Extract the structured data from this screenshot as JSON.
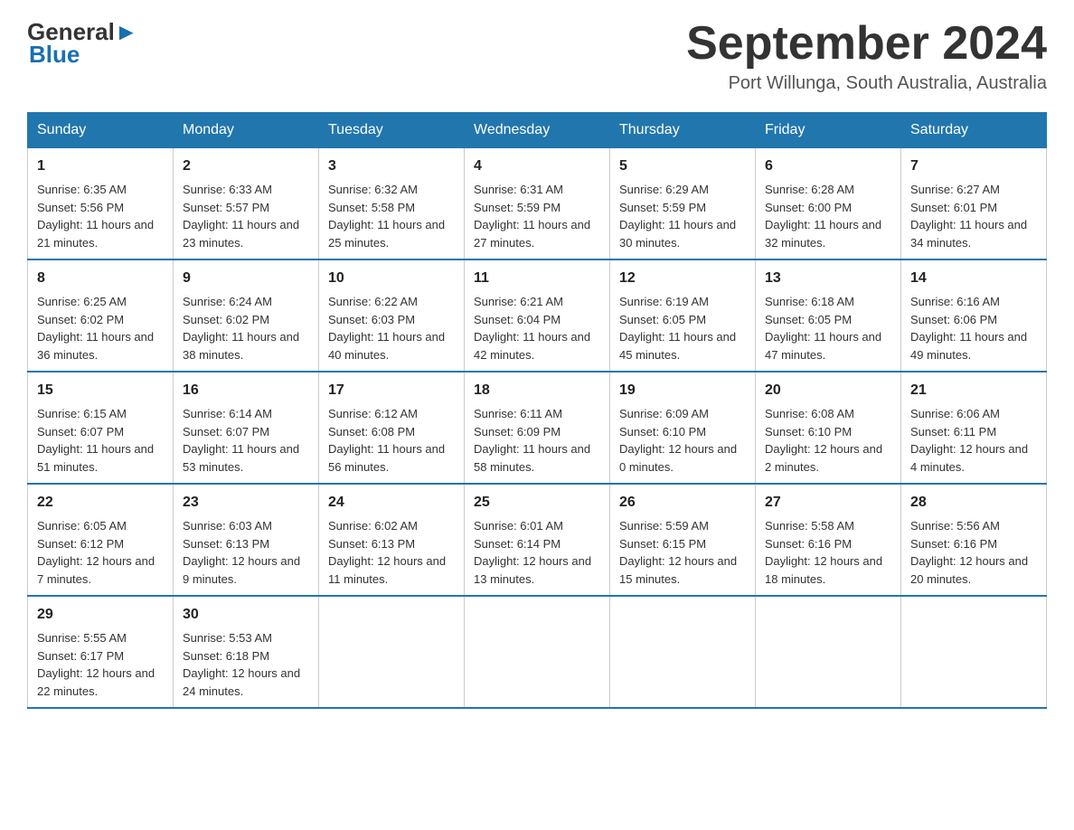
{
  "header": {
    "logo_general": "General",
    "logo_blue": "Blue",
    "month_title": "September 2024",
    "location": "Port Willunga, South Australia, Australia"
  },
  "days_of_week": [
    "Sunday",
    "Monday",
    "Tuesday",
    "Wednesday",
    "Thursday",
    "Friday",
    "Saturday"
  ],
  "weeks": [
    [
      {
        "day": "1",
        "sunrise": "6:35 AM",
        "sunset": "5:56 PM",
        "daylight": "11 hours and 21 minutes."
      },
      {
        "day": "2",
        "sunrise": "6:33 AM",
        "sunset": "5:57 PM",
        "daylight": "11 hours and 23 minutes."
      },
      {
        "day": "3",
        "sunrise": "6:32 AM",
        "sunset": "5:58 PM",
        "daylight": "11 hours and 25 minutes."
      },
      {
        "day": "4",
        "sunrise": "6:31 AM",
        "sunset": "5:59 PM",
        "daylight": "11 hours and 27 minutes."
      },
      {
        "day": "5",
        "sunrise": "6:29 AM",
        "sunset": "5:59 PM",
        "daylight": "11 hours and 30 minutes."
      },
      {
        "day": "6",
        "sunrise": "6:28 AM",
        "sunset": "6:00 PM",
        "daylight": "11 hours and 32 minutes."
      },
      {
        "day": "7",
        "sunrise": "6:27 AM",
        "sunset": "6:01 PM",
        "daylight": "11 hours and 34 minutes."
      }
    ],
    [
      {
        "day": "8",
        "sunrise": "6:25 AM",
        "sunset": "6:02 PM",
        "daylight": "11 hours and 36 minutes."
      },
      {
        "day": "9",
        "sunrise": "6:24 AM",
        "sunset": "6:02 PM",
        "daylight": "11 hours and 38 minutes."
      },
      {
        "day": "10",
        "sunrise": "6:22 AM",
        "sunset": "6:03 PM",
        "daylight": "11 hours and 40 minutes."
      },
      {
        "day": "11",
        "sunrise": "6:21 AM",
        "sunset": "6:04 PM",
        "daylight": "11 hours and 42 minutes."
      },
      {
        "day": "12",
        "sunrise": "6:19 AM",
        "sunset": "6:05 PM",
        "daylight": "11 hours and 45 minutes."
      },
      {
        "day": "13",
        "sunrise": "6:18 AM",
        "sunset": "6:05 PM",
        "daylight": "11 hours and 47 minutes."
      },
      {
        "day": "14",
        "sunrise": "6:16 AM",
        "sunset": "6:06 PM",
        "daylight": "11 hours and 49 minutes."
      }
    ],
    [
      {
        "day": "15",
        "sunrise": "6:15 AM",
        "sunset": "6:07 PM",
        "daylight": "11 hours and 51 minutes."
      },
      {
        "day": "16",
        "sunrise": "6:14 AM",
        "sunset": "6:07 PM",
        "daylight": "11 hours and 53 minutes."
      },
      {
        "day": "17",
        "sunrise": "6:12 AM",
        "sunset": "6:08 PM",
        "daylight": "11 hours and 56 minutes."
      },
      {
        "day": "18",
        "sunrise": "6:11 AM",
        "sunset": "6:09 PM",
        "daylight": "11 hours and 58 minutes."
      },
      {
        "day": "19",
        "sunrise": "6:09 AM",
        "sunset": "6:10 PM",
        "daylight": "12 hours and 0 minutes."
      },
      {
        "day": "20",
        "sunrise": "6:08 AM",
        "sunset": "6:10 PM",
        "daylight": "12 hours and 2 minutes."
      },
      {
        "day": "21",
        "sunrise": "6:06 AM",
        "sunset": "6:11 PM",
        "daylight": "12 hours and 4 minutes."
      }
    ],
    [
      {
        "day": "22",
        "sunrise": "6:05 AM",
        "sunset": "6:12 PM",
        "daylight": "12 hours and 7 minutes."
      },
      {
        "day": "23",
        "sunrise": "6:03 AM",
        "sunset": "6:13 PM",
        "daylight": "12 hours and 9 minutes."
      },
      {
        "day": "24",
        "sunrise": "6:02 AM",
        "sunset": "6:13 PM",
        "daylight": "12 hours and 11 minutes."
      },
      {
        "day": "25",
        "sunrise": "6:01 AM",
        "sunset": "6:14 PM",
        "daylight": "12 hours and 13 minutes."
      },
      {
        "day": "26",
        "sunrise": "5:59 AM",
        "sunset": "6:15 PM",
        "daylight": "12 hours and 15 minutes."
      },
      {
        "day": "27",
        "sunrise": "5:58 AM",
        "sunset": "6:16 PM",
        "daylight": "12 hours and 18 minutes."
      },
      {
        "day": "28",
        "sunrise": "5:56 AM",
        "sunset": "6:16 PM",
        "daylight": "12 hours and 20 minutes."
      }
    ],
    [
      {
        "day": "29",
        "sunrise": "5:55 AM",
        "sunset": "6:17 PM",
        "daylight": "12 hours and 22 minutes."
      },
      {
        "day": "30",
        "sunrise": "5:53 AM",
        "sunset": "6:18 PM",
        "daylight": "12 hours and 24 minutes."
      },
      null,
      null,
      null,
      null,
      null
    ]
  ]
}
